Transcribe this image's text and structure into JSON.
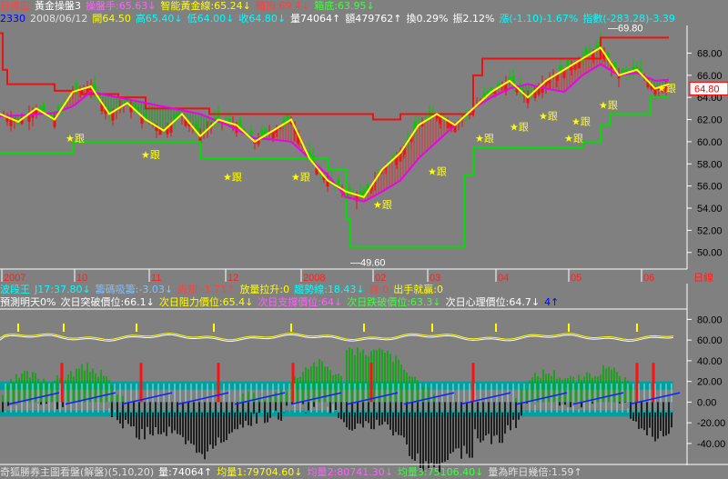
{
  "top_line1": [
    {
      "text": "日線圖",
      "color": "#ff4444"
    },
    {
      "text": "黃金操盤3",
      "color": "#ffffff"
    },
    {
      "text": "操盤手:65.63↓",
      "color": "#ff60ff"
    },
    {
      "text": "智能黃金線:65.24↓",
      "color": "#ffff00"
    },
    {
      "text": "箱頂:69.4↓",
      "color": "#ff4040"
    },
    {
      "text": "箱底:63.95↓",
      "color": "#40ff40"
    }
  ],
  "top_line2": [
    {
      "text": "2330",
      "color": "#0000ff"
    },
    {
      "text": "2008/06/12",
      "color": "#e0e0e0"
    },
    {
      "text": "開64.50",
      "color": "#ffff00"
    },
    {
      "text": "高65.40↓",
      "color": "#00ffff"
    },
    {
      "text": "低64.00↓",
      "color": "#00ffff"
    },
    {
      "text": "收64.80↓",
      "color": "#00ffff"
    },
    {
      "text": "量74064↑",
      "color": "#ffffff"
    },
    {
      "text": "額479762↑",
      "color": "#ffffff"
    },
    {
      "text": "換0.29%",
      "color": "#ffffff"
    },
    {
      "text": "振2.12%",
      "color": "#ffffff"
    },
    {
      "text": "漲(-1.10)-1.67%",
      "color": "#00ffff"
    },
    {
      "text": "指數(-283.28)-3.39",
      "color": "#00ffff"
    }
  ],
  "mid_line1": [
    {
      "text": "波段王",
      "color": "#00ffff"
    },
    {
      "text": "J17:37.80↓",
      "color": "#00ffff"
    },
    {
      "text": "籌碼吸籌:-3.03↓",
      "color": "#80c0ff"
    },
    {
      "text": "先知:-1.71↑",
      "color": "#ff4040"
    },
    {
      "text": "放量拉升:0",
      "color": "#ffff00"
    },
    {
      "text": "趨勢線:18.43↓",
      "color": "#00ffff"
    },
    {
      "text": "買:0",
      "color": "#ff4040"
    },
    {
      "text": "出手就贏:0",
      "color": "#ffff00"
    }
  ],
  "mid_line2": [
    {
      "text": "預測明天0%",
      "color": "#ffffff"
    },
    {
      "text": "次日突破價位:66.1↓",
      "color": "#ffffff"
    },
    {
      "text": "次日阻力價位:65.4↓",
      "color": "#ffff00"
    },
    {
      "text": "次日支撐價位:64↓",
      "color": "#ff60ff"
    },
    {
      "text": "次日跌破價位:63.3↓",
      "color": "#40ff40"
    },
    {
      "text": "次日心理價位:64.7↓",
      "color": "#ffffff"
    },
    {
      "text": "4↑",
      "color": "#0000ff"
    }
  ],
  "bottom_line": [
    {
      "text": "奇狐勝券主圖看盤(解盤)(5,10,20)",
      "color": "#e0e0e0"
    },
    {
      "text": "量:74064↑",
      "color": "#ffffff"
    },
    {
      "text": "均量1:79704.60↓",
      "color": "#ffff00"
    },
    {
      "text": "均量2:80741.30↓",
      "color": "#ff60ff"
    },
    {
      "text": "均量3:75106.40↓",
      "color": "#40ff40"
    },
    {
      "text": "量為昨日幾倍:1.59↑",
      "color": "#e0e0e0"
    }
  ],
  "period_label": "日線",
  "current_price_tag": "64.80",
  "follow_marker_text": "★跟",
  "colors": {
    "background": "#808080",
    "red": "#ee1111",
    "green": "#00dd00",
    "magenta": "#ee00ee",
    "yellow": "#ffff00",
    "cyan": "#00ffff",
    "teal": "#00a0a0",
    "black": "#000000",
    "dark_green": "#007700"
  },
  "chart_data": [
    {
      "type": "line",
      "title": "",
      "xlabel": "",
      "ylabel": "",
      "x_tick_labels": [
        "2007",
        "10",
        "11",
        "12",
        "2008",
        "02",
        "03",
        "04",
        "05",
        "06"
      ],
      "ylim": [
        48.5,
        70.5
      ],
      "y_ticks": [
        50,
        52,
        54,
        56,
        58,
        60,
        62,
        64,
        66,
        68
      ],
      "annotations": [
        {
          "text": "69.80",
          "x": "2008-05"
        },
        {
          "text": "49.60",
          "x": "2008-01"
        }
      ],
      "current_value": 64.8,
      "series": [
        {
          "name": "箱頂",
          "color": "#ee1111",
          "values": [
            [
              0,
              69.8
            ],
            [
              3,
              66.5
            ],
            [
              8,
              65.2
            ],
            [
              20,
              65.2
            ],
            [
              60,
              64.6
            ],
            [
              90,
              64.3
            ],
            [
              130,
              64.0
            ],
            [
              160,
              63.0
            ],
            [
              200,
              63.0
            ],
            [
              230,
              62.5
            ],
            [
              270,
              62.5
            ],
            [
              350,
              62.5
            ],
            [
              400,
              62.5
            ],
            [
              410,
              62.0
            ],
            [
              440,
              62.5
            ],
            [
              470,
              62.5
            ],
            [
              500,
              62.5
            ],
            [
              520,
              66.0
            ],
            [
              530,
              67.5
            ],
            [
              550,
              67.5
            ],
            [
              600,
              67.5
            ],
            [
              650,
              67.5
            ],
            [
              660,
              69.4
            ],
            [
              735,
              69.4
            ]
          ]
        },
        {
          "name": "箱底",
          "color": "#00dd00",
          "values": [
            [
              0,
              59.0
            ],
            [
              60,
              59.0
            ],
            [
              80,
              60.0
            ],
            [
              180,
              60.0
            ],
            [
              220,
              58.5
            ],
            [
              300,
              58.5
            ],
            [
              350,
              58.5
            ],
            [
              360,
              57.5
            ],
            [
              380,
              53.0
            ],
            [
              385,
              50.5
            ],
            [
              400,
              50.5
            ],
            [
              470,
              50.5
            ],
            [
              500,
              50.5
            ],
            [
              510,
              57.0
            ],
            [
              520,
              59.5
            ],
            [
              560,
              59.5
            ],
            [
              600,
              59.5
            ],
            [
              640,
              60.0
            ],
            [
              660,
              61.5
            ],
            [
              670,
              62.5
            ],
            [
              700,
              62.5
            ],
            [
              715,
              64.0
            ],
            [
              735,
              64.0
            ]
          ]
        },
        {
          "name": "操盤手",
          "color": "#ee00ee",
          "values": [
            [
              0,
              62.3
            ],
            [
              30,
              62.4
            ],
            [
              60,
              62.6
            ],
            [
              80,
              63.2
            ],
            [
              100,
              64.5
            ],
            [
              130,
              64.0
            ],
            [
              160,
              63.5
            ],
            [
              190,
              63.0
            ],
            [
              220,
              62.5
            ],
            [
              250,
              61.5
            ],
            [
              280,
              60.3
            ],
            [
              300,
              60.2
            ],
            [
              320,
              60.0
            ],
            [
              340,
              58.5
            ],
            [
              360,
              57.0
            ],
            [
              380,
              55.0
            ],
            [
              400,
              54.6
            ],
            [
              420,
              55.5
            ],
            [
              440,
              56.5
            ],
            [
              460,
              58.5
            ],
            [
              480,
              60.0
            ],
            [
              500,
              61.5
            ],
            [
              520,
              63.0
            ],
            [
              540,
              64.0
            ],
            [
              560,
              64.8
            ],
            [
              580,
              65.2
            ],
            [
              600,
              64.8
            ],
            [
              620,
              64.5
            ],
            [
              640,
              66.0
            ],
            [
              660,
              67.0
            ],
            [
              680,
              66.0
            ],
            [
              700,
              66.2
            ],
            [
              720,
              65.5
            ],
            [
              735,
              65.6
            ]
          ]
        },
        {
          "name": "智能黃金線",
          "color": "#ffff00",
          "values": [
            [
              0,
              62.5
            ],
            [
              20,
              61.8
            ],
            [
              40,
              63.0
            ],
            [
              60,
              62.0
            ],
            [
              80,
              64.5
            ],
            [
              100,
              65.0
            ],
            [
              120,
              62.5
            ],
            [
              140,
              63.5
            ],
            [
              160,
              62.0
            ],
            [
              180,
              61.0
            ],
            [
              200,
              62.5
            ],
            [
              220,
              60.5
            ],
            [
              240,
              62.0
            ],
            [
              260,
              61.5
            ],
            [
              280,
              60.0
            ],
            [
              300,
              61.0
            ],
            [
              320,
              62.0
            ],
            [
              340,
              58.5
            ],
            [
              360,
              56.5
            ],
            [
              380,
              55.5
            ],
            [
              400,
              55.0
            ],
            [
              420,
              57.5
            ],
            [
              440,
              59.0
            ],
            [
              460,
              61.5
            ],
            [
              480,
              62.5
            ],
            [
              500,
              61.5
            ],
            [
              520,
              63.0
            ],
            [
              540,
              64.5
            ],
            [
              560,
              65.5
            ],
            [
              580,
              64.0
            ],
            [
              600,
              65.5
            ],
            [
              620,
              66.5
            ],
            [
              640,
              67.5
            ],
            [
              660,
              68.5
            ],
            [
              680,
              66.0
            ],
            [
              700,
              66.5
            ],
            [
              720,
              64.8
            ],
            [
              735,
              65.2
            ]
          ]
        }
      ],
      "markers": [
        {
          "x": "2007-10",
          "y": 60.0
        },
        {
          "x": "2007-11",
          "y": 58.5
        },
        {
          "x": "2007-12",
          "y": 56.5
        },
        {
          "x": "2008-01",
          "y": 56.5
        },
        {
          "x": "2008-01",
          "y": 54.0
        },
        {
          "x": "2008-03",
          "y": 57.0
        },
        {
          "x": "2008-03",
          "y": 60.0
        },
        {
          "x": "2008-04",
          "y": 61.0
        },
        {
          "x": "2008-04",
          "y": 62.0
        },
        {
          "x": "2008-05",
          "y": 60.0
        },
        {
          "x": "2008-05",
          "y": 61.5
        },
        {
          "x": "2008-05",
          "y": 63.0
        },
        {
          "x": "2008-06",
          "y": 64.5
        }
      ]
    },
    {
      "type": "line",
      "title": "",
      "ylim": [
        -48,
        90
      ],
      "y_ticks": [
        80,
        60,
        40,
        20,
        0,
        -20,
        -40
      ]
    }
  ]
}
